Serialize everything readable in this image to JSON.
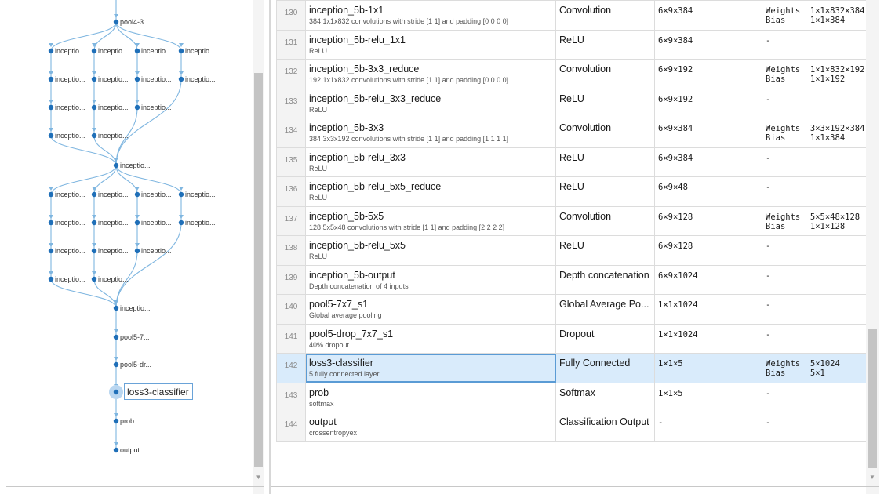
{
  "colors": {
    "accent": "#1f6fb8",
    "edge": "#7fb6e0",
    "selection": "#d9ebfb"
  },
  "graph": {
    "nodes": [
      {
        "id": "n_pool4",
        "label": "pool4-3...",
        "lbl": "pool4-3..."
      },
      {
        "id": "a1",
        "label": "inceptio..."
      },
      {
        "id": "a2",
        "label": "inceptio..."
      },
      {
        "id": "a3",
        "label": "inceptio..."
      },
      {
        "id": "a4",
        "label": "inceptio..."
      },
      {
        "id": "b1",
        "label": "inceptio..."
      },
      {
        "id": "b2",
        "label": "inceptio..."
      },
      {
        "id": "b3",
        "label": "inceptio..."
      },
      {
        "id": "b4",
        "label": "inceptio..."
      },
      {
        "id": "c1",
        "label": "inceptio..."
      },
      {
        "id": "c2",
        "label": "inceptio..."
      },
      {
        "id": "c3",
        "label": "inceptio..."
      },
      {
        "id": "d1",
        "label": "inceptio..."
      },
      {
        "id": "d2",
        "label": "inceptio..."
      },
      {
        "id": "m1",
        "label": "inceptio..."
      },
      {
        "id": "e1",
        "label": "inceptio..."
      },
      {
        "id": "e2",
        "label": "inceptio..."
      },
      {
        "id": "e3",
        "label": "inceptio..."
      },
      {
        "id": "e4",
        "label": "inceptio..."
      },
      {
        "id": "f1",
        "label": "inceptio..."
      },
      {
        "id": "f2",
        "label": "inceptio..."
      },
      {
        "id": "f3",
        "label": "inceptio..."
      },
      {
        "id": "f4",
        "label": "inceptio..."
      },
      {
        "id": "g1",
        "label": "inceptio..."
      },
      {
        "id": "g2",
        "label": "inceptio..."
      },
      {
        "id": "g3",
        "label": "inceptio..."
      },
      {
        "id": "h1",
        "label": "inceptio..."
      },
      {
        "id": "h2",
        "label": "inceptio..."
      },
      {
        "id": "m2",
        "label": "inceptio..."
      },
      {
        "id": "pool5a",
        "label": "pool5-7..."
      },
      {
        "id": "pool5b",
        "label": "pool5-dr..."
      },
      {
        "id": "loss3",
        "label": "loss3-classifier",
        "selected": true
      },
      {
        "id": "prob",
        "label": "prob"
      },
      {
        "id": "output",
        "label": "output"
      }
    ]
  },
  "table": {
    "rows": [
      {
        "num": "130",
        "name": "inception_5b-1x1",
        "desc": "384 1x1x832 convolutions with stride [1  1] and padding [0  0  0  0]",
        "type": "Convolution",
        "act": "6×9×384",
        "learn": "Weights  1×1×832×384\nBias     1×1×384"
      },
      {
        "num": "131",
        "name": "inception_5b-relu_1x1",
        "desc": "ReLU",
        "type": "ReLU",
        "act": "6×9×384",
        "learn": "-"
      },
      {
        "num": "132",
        "name": "inception_5b-3x3_reduce",
        "desc": "192 1x1x832 convolutions with stride [1  1] and padding [0  0  0  0]",
        "type": "Convolution",
        "act": "6×9×192",
        "learn": "Weights  1×1×832×192\nBias     1×1×192"
      },
      {
        "num": "133",
        "name": "inception_5b-relu_3x3_reduce",
        "desc": "ReLU",
        "type": "ReLU",
        "act": "6×9×192",
        "learn": "-"
      },
      {
        "num": "134",
        "name": "inception_5b-3x3",
        "desc": "384 3x3x192 convolutions with stride [1  1] and padding [1  1  1  1]",
        "type": "Convolution",
        "act": "6×9×384",
        "learn": "Weights  3×3×192×384\nBias     1×1×384"
      },
      {
        "num": "135",
        "name": "inception_5b-relu_3x3",
        "desc": "ReLU",
        "type": "ReLU",
        "act": "6×9×384",
        "learn": "-"
      },
      {
        "num": "136",
        "name": "inception_5b-relu_5x5_reduce",
        "desc": "ReLU",
        "type": "ReLU",
        "act": "6×9×48",
        "learn": "-"
      },
      {
        "num": "137",
        "name": "inception_5b-5x5",
        "desc": "128 5x5x48 convolutions with stride [1  1] and padding [2  2  2  2]",
        "type": "Convolution",
        "act": "6×9×128",
        "learn": "Weights  5×5×48×128\nBias     1×1×128"
      },
      {
        "num": "138",
        "name": "inception_5b-relu_5x5",
        "desc": "ReLU",
        "type": "ReLU",
        "act": "6×9×128",
        "learn": "-"
      },
      {
        "num": "139",
        "name": "inception_5b-output",
        "desc": "Depth concatenation of 4 inputs",
        "type": "Depth concatenation",
        "act": "6×9×1024",
        "learn": "-"
      },
      {
        "num": "140",
        "name": "pool5-7x7_s1",
        "desc": "Global average pooling",
        "type": "Global Average Po...",
        "act": "1×1×1024",
        "learn": "-"
      },
      {
        "num": "141",
        "name": "pool5-drop_7x7_s1",
        "desc": "40% dropout",
        "type": "Dropout",
        "act": "1×1×1024",
        "learn": "-"
      },
      {
        "num": "142",
        "name": "loss3-classifier",
        "desc": "5 fully connected layer",
        "type": "Fully Connected",
        "act": "1×1×5",
        "learn": "Weights  5×1024\nBias     5×1",
        "selected": true
      },
      {
        "num": "143",
        "name": "prob",
        "desc": "softmax",
        "type": "Softmax",
        "act": "1×1×5",
        "learn": "-"
      },
      {
        "num": "144",
        "name": "output",
        "desc": "crossentropyex",
        "type": "Classification Output",
        "act": "-",
        "learn": "-"
      }
    ]
  }
}
